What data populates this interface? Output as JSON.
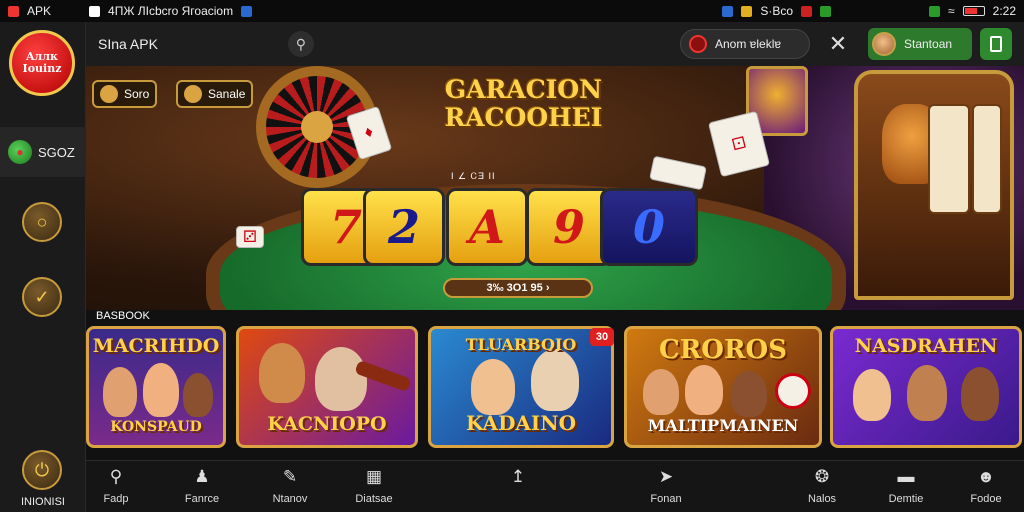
{
  "status_bar": {
    "left_label": "APK",
    "notification_text": "4ПЖ ЛІсbcro Ягоасіоm",
    "right_text": "S·Bco",
    "time": "2:22"
  },
  "sidebar": {
    "logo_line1": "Aллк",
    "logo_line2": "Iouinz",
    "active_item_label": "SGOZ",
    "bottom_label": "INIONISI"
  },
  "header": {
    "app_title": "SIna APK",
    "account_label": "Anom ɐleklɐ",
    "start_label": "Stantoan"
  },
  "hero": {
    "tag1_label": "Soro",
    "tag2_label": "Sanale",
    "title_line1": "GARACION",
    "title_line2": "RACOOHEI",
    "subline": "I ∠ ᏟƎ II",
    "tiles": [
      "7",
      "2",
      "A",
      "9",
      "0"
    ],
    "score_text": "3‰ 3O1 95 ›"
  },
  "section": {
    "label": "BASBOOK"
  },
  "games": [
    {
      "title_top": "MACRIHDO",
      "title_bottom": "KONSPAUD"
    },
    {
      "title_top": "",
      "title_bottom": "KACNIOPO"
    },
    {
      "title_top": "TLUARBOIO",
      "title_bottom": "KADAINO",
      "badge": "30"
    },
    {
      "title_top": "CROROS",
      "title_bottom": "MALTIPMAINEN"
    },
    {
      "title_top": "NASDRAHEN",
      "title_bottom": ""
    }
  ],
  "bottom_nav": [
    {
      "label": "Fadp",
      "icon": "search-icon"
    },
    {
      "label": "Fanrce",
      "icon": "players-icon"
    },
    {
      "label": "Ntanov",
      "icon": "pencil-icon"
    },
    {
      "label": "Diatsae",
      "icon": "film-icon"
    },
    {
      "label": "",
      "icon": "arrow-icon"
    },
    {
      "label": "Fonan",
      "icon": "rocket-icon"
    },
    {
      "label": "Nalos",
      "icon": "compass-icon"
    },
    {
      "label": "Demtie",
      "icon": "chat-icon"
    },
    {
      "label": "Fodoe",
      "icon": "user-icon"
    }
  ],
  "colors": {
    "accent_gold": "#d9a441",
    "table_green": "#1f8a3a",
    "start_green": "#2d7a2d",
    "logo_red": "#c00000"
  }
}
